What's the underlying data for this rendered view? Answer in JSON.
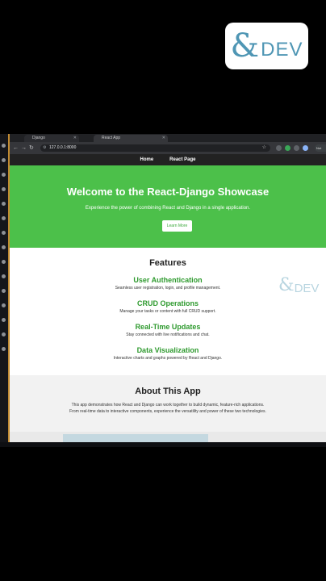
{
  "brand": {
    "amp": "&",
    "text": "DEV"
  },
  "browser": {
    "tabs": [
      {
        "label": "Django",
        "active": false
      },
      {
        "label": "React App",
        "active": true
      }
    ],
    "url": "127.0.0.1:8000",
    "profile_label": "Not"
  },
  "site": {
    "nav": [
      "Home",
      "React Page"
    ],
    "hero": {
      "title": "Welcome to the React-Django Showcase",
      "subtitle": "Experience the power of combining React and Django in a single application.",
      "button": "Learn More"
    },
    "features": {
      "heading": "Features",
      "items": [
        {
          "title": "User Authentication",
          "desc": "Seamless user registration, login, and profile management."
        },
        {
          "title": "CRUD Operations",
          "desc": "Manage your tasks or content with full CRUD support."
        },
        {
          "title": "Real-Time Updates",
          "desc": "Stay connected with live notifications and chat."
        },
        {
          "title": "Data Visualization",
          "desc": "Interactive charts and graphs powered by React and Django."
        }
      ]
    },
    "about": {
      "heading": "About This App",
      "line1": "This app demonstrates how React and Django can work together to build dynamic, feature-rich applications.",
      "line2": "From real-time data to interactive components, experience the versatility and power of these two technologies."
    }
  },
  "colors": {
    "hero": "#4cc04a",
    "accent_green": "#2e9a2e",
    "brand_blue": "#4f96b4"
  }
}
